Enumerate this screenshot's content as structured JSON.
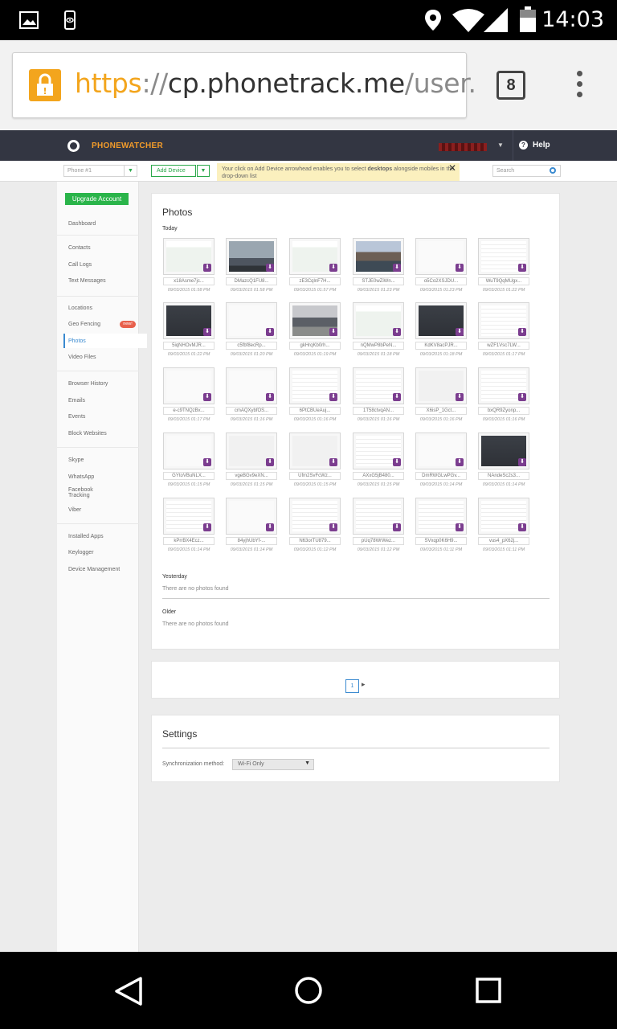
{
  "status_bar": {
    "time": "14:03",
    "icons": [
      "image-icon",
      "device-eye-icon",
      "location-icon",
      "wifi-icon",
      "signal-icon",
      "battery-icon"
    ]
  },
  "browser": {
    "url_scheme": "https",
    "url_sep": "://",
    "url_host": "cp.phonetrack.me",
    "url_path": "/user.",
    "tab_count": "8"
  },
  "app": {
    "brand": "PHONEWATCHER",
    "help": "Help",
    "phone_select": "Phone #1",
    "add_device": "Add Device",
    "hint_pre": "Your click on Add Device arrowhead enables you to select ",
    "hint_bold": "desktops",
    "hint_post": " alongside mobiles in the drop-down list",
    "search_placeholder": "Search"
  },
  "sidebar": {
    "upgrade": "Upgrade Account",
    "items": {
      "dashboard": "Dashboard",
      "contacts": "Contacts",
      "call_logs": "Call Logs",
      "text_messages": "Text Messages",
      "locations": "Locations",
      "geo_fencing": "Geo Fencing",
      "new_badge": "new!",
      "photos": "Photos",
      "video_files": "Video Files",
      "browser_history": "Browser History",
      "emails": "Emails",
      "events": "Events",
      "block_websites": "Block Websites",
      "skype": "Skype",
      "whatsapp": "WhatsApp",
      "facebook_tracking_1": "Facebook",
      "facebook_tracking_2": "Tracking",
      "viber": "Viber",
      "installed_apps": "Installed Apps",
      "keylogger": "Keylogger",
      "device_management": "Device Management"
    }
  },
  "photos": {
    "title": "Photos",
    "today": "Today",
    "yesterday": "Yesterday",
    "older": "Older",
    "no_photos": "There are no photos found",
    "items": [
      {
        "name": "x18Asme7jc...",
        "date": "09/03/2015 01:58 PM",
        "style": "ui-map"
      },
      {
        "name": "DMazcQ1FU8...",
        "date": "09/03/2015 01:58 PM",
        "style": "photo-sky"
      },
      {
        "name": "zE3CqlnF7H...",
        "date": "09/03/2015 01:57 PM",
        "style": "ui-map"
      },
      {
        "name": "STJE0wZiWn...",
        "date": "09/03/2015 01:23 PM",
        "style": "photo-city"
      },
      {
        "name": "o5Co2XSJDU...",
        "date": "09/03/2015 01:23 PM",
        "style": "ui-light"
      },
      {
        "name": "WuT9QqMUgx...",
        "date": "09/03/2015 01:22 PM",
        "style": "ui-table"
      },
      {
        "name": "5iqNHOvMJR...",
        "date": "09/03/2015 01:22 PM",
        "style": "ui-dark"
      },
      {
        "name": "c5fbf8ecRp...",
        "date": "09/03/2015 01:20 PM",
        "style": "ui-light"
      },
      {
        "name": "gkHrqKb0rh...",
        "date": "09/03/2015 01:19 PM",
        "style": "photo-street"
      },
      {
        "name": "nQMwP8bPeN...",
        "date": "09/03/2015 01:18 PM",
        "style": "ui-map"
      },
      {
        "name": "KdKV8acPJR...",
        "date": "09/03/2015 01:18 PM",
        "style": "ui-dark"
      },
      {
        "name": "wZF1Vsc7LW...",
        "date": "09/03/2015 01:17 PM",
        "style": "ui-table"
      },
      {
        "name": "e-c9TNQzBx...",
        "date": "09/03/2015 01:17 PM",
        "style": "ui-light"
      },
      {
        "name": "cmAQXybfOS...",
        "date": "09/03/2015 01:16 PM",
        "style": "ui-light"
      },
      {
        "name": "6PtCBUeAuj...",
        "date": "09/03/2015 01:16 PM",
        "style": "ui-table"
      },
      {
        "name": "1T58ctvqAN...",
        "date": "09/03/2015 01:16 PM",
        "style": "ui-table"
      },
      {
        "name": "X6isP_1Gct...",
        "date": "09/03/2015 01:16 PM",
        "style": "ui-blank"
      },
      {
        "name": "bxQR9Zyonp...",
        "date": "09/03/2015 01:16 PM",
        "style": "ui-table"
      },
      {
        "name": "GYtoVBuNLX...",
        "date": "09/03/2015 01:15 PM",
        "style": "ui-light"
      },
      {
        "name": "vgeBGv9eXN...",
        "date": "09/03/2015 01:15 PM",
        "style": "ui-blank"
      },
      {
        "name": "Ufm2SvFcWz...",
        "date": "09/03/2015 01:15 PM",
        "style": "ui-blank"
      },
      {
        "name": "AXxG5jB480...",
        "date": "09/03/2015 01:15 PM",
        "style": "ui-table"
      },
      {
        "name": "DmRWGLwPGv...",
        "date": "09/03/2015 01:14 PM",
        "style": "ui-light"
      },
      {
        "name": "NAndeSc2s3...",
        "date": "09/03/2015 01:14 PM",
        "style": "ui-dark"
      },
      {
        "name": "kPrrBX4Ecz...",
        "date": "09/03/2015 01:14 PM",
        "style": "ui-table"
      },
      {
        "name": "84yjhUbYf-...",
        "date": "09/03/2015 01:14 PM",
        "style": "ui-light"
      },
      {
        "name": "N63orTU879...",
        "date": "09/03/2015 01:12 PM",
        "style": "ui-table"
      },
      {
        "name": "pUq78WrWez...",
        "date": "09/03/2015 01:12 PM",
        "style": "ui-table"
      },
      {
        "name": "SVxqp0K6H9...",
        "date": "09/03/2015 01:11 PM",
        "style": "ui-table"
      },
      {
        "name": "vus4_pX62j...",
        "date": "09/03/2015 01:11 PM",
        "style": "ui-table"
      }
    ]
  },
  "pagination": {
    "current": "1",
    "next": "▸"
  },
  "settings": {
    "title": "Settings",
    "sync_label": "Synchronization method:",
    "sync_value": "Wi-Fi Only"
  },
  "nav": {
    "icons": [
      "back-icon",
      "home-icon",
      "recents-icon"
    ]
  },
  "colors": {
    "accent": "#3a8ad0",
    "brand": "#f39c2a",
    "upgrade": "#2ab44a",
    "download": "#7b3d8f"
  }
}
